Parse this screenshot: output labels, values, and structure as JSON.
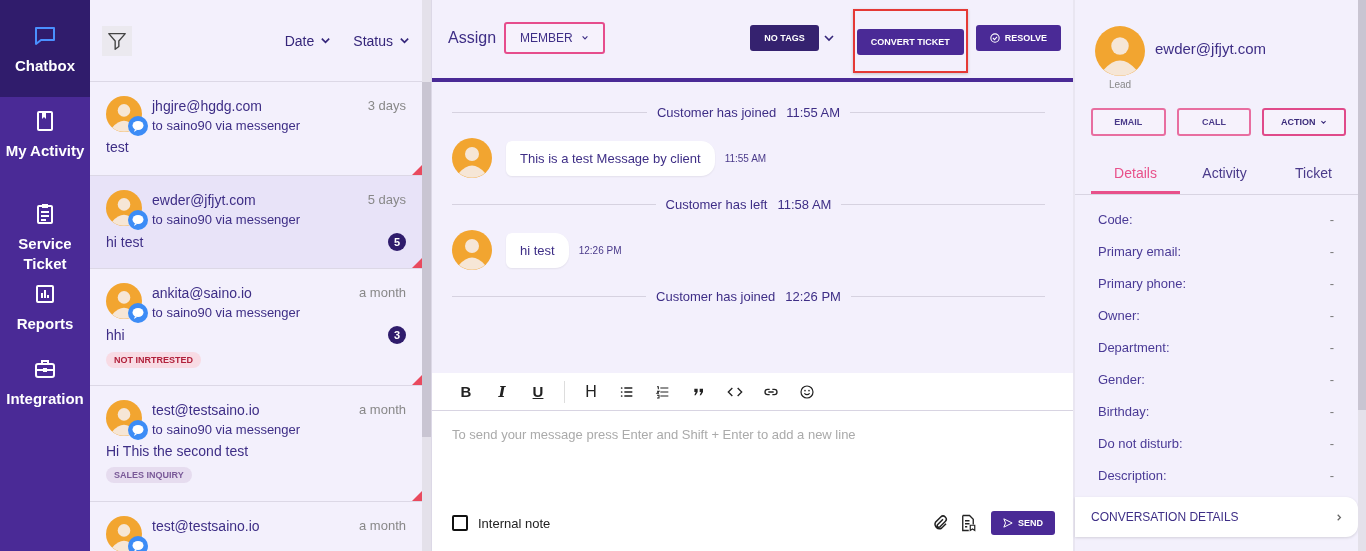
{
  "sidebar": {
    "items": [
      {
        "label": "Chatbox",
        "kind": "chat",
        "selected": true
      },
      {
        "label": "My Activity",
        "kind": "bookmark",
        "selected": false
      },
      {
        "label": "Service Ticket",
        "kind": "clipboard",
        "selected": false
      },
      {
        "label": "Reports",
        "kind": "chart",
        "selected": false
      },
      {
        "label": "Integration",
        "kind": "briefcase",
        "selected": false
      }
    ]
  },
  "conversation_list": {
    "filters": [
      "Date",
      "Status"
    ],
    "items": [
      {
        "email": "jhgjre@hgdg.com",
        "time": "3 days",
        "via": "to saino90 via messenger",
        "preview": "test",
        "selected": false
      },
      {
        "email": "ewder@jfjyt.com",
        "time": "5 days",
        "via": "to saino90 via messenger",
        "preview": "hi test",
        "unread": "5",
        "selected": true
      },
      {
        "email": "ankita@saino.io",
        "time": "a month",
        "via": "to saino90 via messenger",
        "preview": "hhi",
        "unread": "3",
        "tag": {
          "label": "NOT INRTRESTED",
          "color": "#f8dbe4"
        },
        "selected": false
      },
      {
        "email": "test@testsaino.io",
        "time": "a month",
        "via": "to saino90 via messenger",
        "preview": "Hi This the second test",
        "tag": {
          "label": "SALES INQUIRY",
          "color": "#e6dcef"
        },
        "selected": false
      },
      {
        "email": "test@testsaino.io",
        "time": "a month",
        "selected": false
      }
    ]
  },
  "chat": {
    "assign_label": "Assign",
    "assignee": "MEMBER",
    "actions": [
      {
        "label": "NO TAGS",
        "kind": "tags",
        "highlighted": false
      },
      {
        "label": "CONVERT TICKET",
        "kind": "plain",
        "highlighted": true
      },
      {
        "label": "RESOLVE",
        "kind": "resolve",
        "highlighted": false
      }
    ],
    "messages": [
      {
        "kind": "event",
        "text": "Customer has joined",
        "time": "11:55 AM"
      },
      {
        "kind": "message",
        "text": "This is a test Message by client",
        "time": "11:55 AM"
      },
      {
        "kind": "event",
        "text": "Customer has left",
        "time": "11:58 AM"
      },
      {
        "kind": "message",
        "text": "hi test",
        "time": "12:26 PM"
      },
      {
        "kind": "event",
        "text": "Customer has joined",
        "time": "12:26 PM"
      }
    ],
    "editor": {
      "toolbar": [
        {
          "kind": "bold",
          "label": "B"
        },
        {
          "kind": "italic",
          "label": "I"
        },
        {
          "kind": "underline",
          "label": "U"
        },
        {
          "kind": "heading",
          "label": "H"
        },
        {
          "kind": "bullets"
        },
        {
          "kind": "numbers"
        },
        {
          "kind": "quote"
        },
        {
          "kind": "code"
        },
        {
          "kind": "link"
        },
        {
          "kind": "emoji"
        }
      ],
      "placeholder": "To send your message press Enter and Shift + Enter to add a new line",
      "internal_note": {
        "label": "Internal note",
        "checked": false
      },
      "send": "SEND"
    }
  },
  "contact": {
    "email": "ewder@jfjyt.com",
    "role": "Lead",
    "buttons": [
      {
        "label": "EMAIL",
        "kind": "plain"
      },
      {
        "label": "CALL",
        "kind": "plain"
      },
      {
        "label": "ACTION",
        "kind": "dropdown"
      }
    ],
    "tabs": [
      {
        "label": "Details",
        "selected": true
      },
      {
        "label": "Activity",
        "selected": false
      },
      {
        "label": "Ticket",
        "selected": false
      }
    ],
    "details": [
      {
        "label": "Code:",
        "value": "-"
      },
      {
        "label": "Primary email:",
        "value": "-"
      },
      {
        "label": "Primary phone:",
        "value": "-"
      },
      {
        "label": "Owner:",
        "value": "-"
      },
      {
        "label": "Department:",
        "value": "-"
      },
      {
        "label": "Gender:",
        "value": "-"
      },
      {
        "label": "Birthday:",
        "value": "-"
      },
      {
        "label": "Do not disturb:",
        "value": "-"
      },
      {
        "label": "Description:",
        "value": "-"
      }
    ],
    "footer": "CONVERSATION DETAILS"
  }
}
